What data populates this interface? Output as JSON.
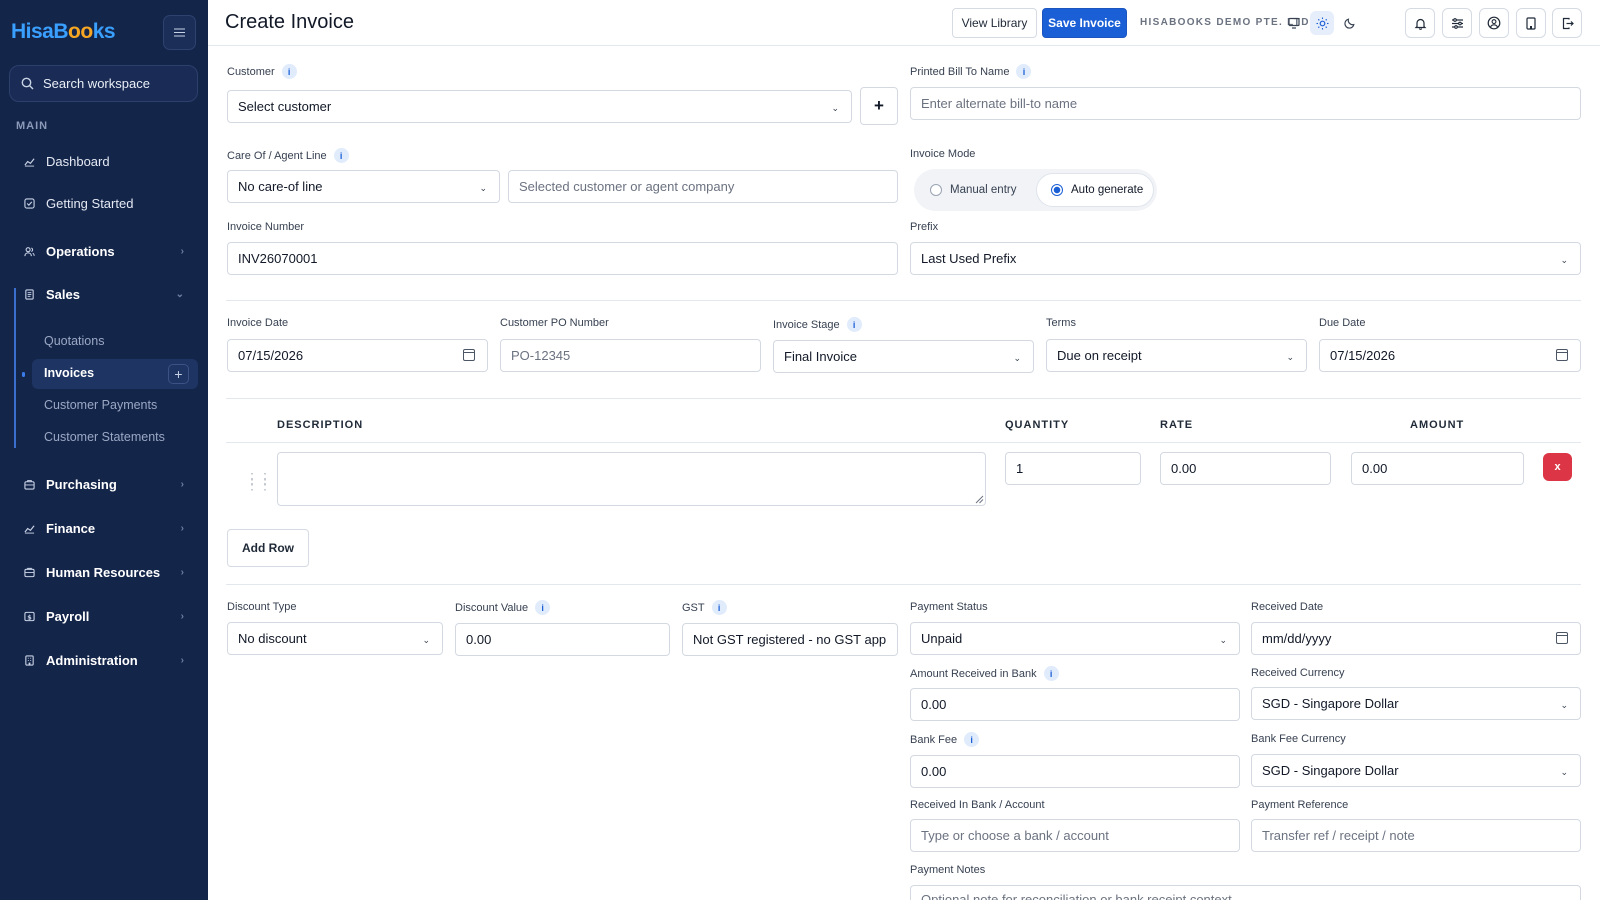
{
  "brand": {
    "logo_part1": "HisaB",
    "logo_part2": "oo",
    "logo_part3": "ks"
  },
  "sidebar": {
    "search_label": "Search workspace",
    "section_main": "MAIN",
    "items": {
      "dashboard": "Dashboard",
      "getting_started": "Getting Started",
      "operations": "Operations",
      "sales": "Sales",
      "purchasing": "Purchasing",
      "finance": "Finance",
      "human_resources": "Human Resources",
      "payroll": "Payroll",
      "administration": "Administration"
    },
    "sales_sub": {
      "quotations": "Quotations",
      "invoices": "Invoices",
      "customer_payments": "Customer Payments",
      "customer_statements": "Customer Statements"
    }
  },
  "header": {
    "title": "Create Invoice",
    "view_library": "View Library",
    "save_invoice": "Save Invoice",
    "company": "HISABOOKS DEMO PTE. LTD."
  },
  "form": {
    "customer_label": "Customer",
    "customer_value": "Select customer",
    "bill_to_label": "Printed Bill To Name",
    "bill_to_placeholder": "Enter alternate bill-to name",
    "care_of_label": "Care Of / Agent Line",
    "care_of_value": "No care-of line",
    "care_of_company_placeholder": "Selected customer or agent company",
    "invoice_mode_label": "Invoice Mode",
    "mode_manual": "Manual entry",
    "mode_auto": "Auto generate",
    "invoice_number_label": "Invoice Number",
    "invoice_number_value": "INV26070001",
    "prefix_label": "Prefix",
    "prefix_value": "Last Used Prefix",
    "invoice_date_label": "Invoice Date",
    "invoice_date_value": "07/15/2026",
    "po_label": "Customer PO Number",
    "po_placeholder": "PO-12345",
    "stage_label": "Invoice Stage",
    "stage_value": "Final Invoice",
    "terms_label": "Terms",
    "terms_value": "Due on receipt",
    "due_date_label": "Due Date",
    "due_date_value": "07/15/2026"
  },
  "lines": {
    "headers": {
      "description": "DESCRIPTION",
      "quantity": "QUANTITY",
      "rate": "RATE",
      "amount": "AMOUNT"
    },
    "rows": [
      {
        "description": "",
        "quantity": "1",
        "rate": "0.00",
        "amount": "0.00"
      }
    ],
    "delete_label": "x",
    "add_row": "Add Row"
  },
  "totals": {
    "discount_type_label": "Discount Type",
    "discount_type_value": "No discount",
    "discount_value_label": "Discount Value",
    "discount_value": "0.00",
    "gst_label": "GST",
    "gst_value": "Not GST registered - no GST app"
  },
  "payment": {
    "status_label": "Payment Status",
    "status_value": "Unpaid",
    "received_date_label": "Received Date",
    "received_date_value": "mm/dd/yyyy",
    "amount_received_label": "Amount Received in Bank",
    "amount_received_value": "0.00",
    "received_currency_label": "Received Currency",
    "received_currency_value": "SGD - Singapore Dollar",
    "bank_fee_label": "Bank Fee",
    "bank_fee_value": "0.00",
    "bank_fee_currency_label": "Bank Fee Currency",
    "bank_fee_currency_value": "SGD - Singapore Dollar",
    "bank_account_label": "Received In Bank / Account",
    "bank_account_placeholder": "Type or choose a bank / account",
    "reference_label": "Payment Reference",
    "reference_placeholder": "Transfer ref / receipt / note",
    "notes_label": "Payment Notes",
    "notes_placeholder": "Optional note for reconciliation or bank receipt context"
  },
  "icons": {
    "info": "i",
    "add": "+",
    "caret": "⌄"
  },
  "colors": {
    "sidebar_bg": "#14254a",
    "primary": "#1b5fd6",
    "danger": "#dc3545"
  }
}
